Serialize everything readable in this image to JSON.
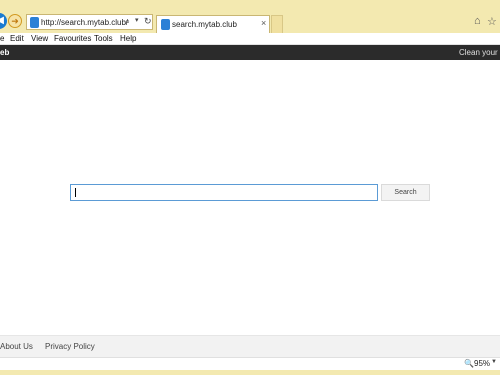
{
  "address_bar": {
    "url": "http://search.mytab.club/",
    "search_icon": "search-icon",
    "dropdown_icon": "chevron-down-icon",
    "refresh_icon": "refresh-icon"
  },
  "tab": {
    "title": "search.mytab.club",
    "close_glyph": "×"
  },
  "menu": {
    "items": [
      "e",
      "Edit",
      "View",
      "Favourites",
      "Tools",
      "Help"
    ]
  },
  "site_bar": {
    "left_text": "eb",
    "right_text": "Clean your M"
  },
  "search": {
    "input_value": "",
    "button_label": "Search"
  },
  "footer": {
    "links": [
      "About Us",
      "Privacy Policy"
    ]
  },
  "status": {
    "zoom": "95%"
  },
  "colors": {
    "frame": "#f3e9b0",
    "dark_bar": "#2b2b2b",
    "input_border": "#5b9bd5",
    "brand_blue": "#2b80d6"
  }
}
